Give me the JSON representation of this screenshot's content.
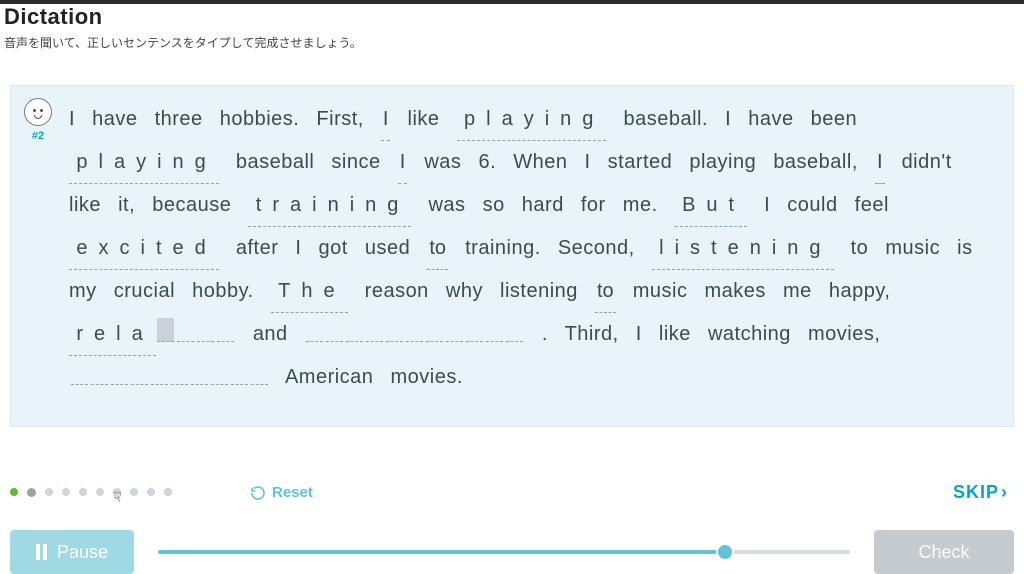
{
  "header": {
    "title": "Dictation",
    "subtitle": "音声を聞いて、正しいセンテンスをタイプして完成させましょう。"
  },
  "avatar": {
    "tag": "#2"
  },
  "tokens": [
    {
      "t": "w",
      "v": "I"
    },
    {
      "t": "w",
      "v": "have"
    },
    {
      "t": "w",
      "v": "three"
    },
    {
      "t": "w",
      "v": "hobbies."
    },
    {
      "t": "w",
      "v": "First,"
    },
    {
      "t": "fw",
      "v": "I"
    },
    {
      "t": "w",
      "v": "like"
    },
    {
      "t": "fw",
      "v": "playing"
    },
    {
      "t": "w",
      "v": "baseball."
    },
    {
      "t": "w",
      "v": "I"
    },
    {
      "t": "w",
      "v": "have"
    },
    {
      "t": "w",
      "v": "been"
    },
    {
      "t": "fw",
      "v": "playing"
    },
    {
      "t": "w",
      "v": "baseball"
    },
    {
      "t": "w",
      "v": "since"
    },
    {
      "t": "fw",
      "v": "I"
    },
    {
      "t": "w",
      "v": "was"
    },
    {
      "t": "w",
      "v": "6."
    },
    {
      "t": "w",
      "v": "When"
    },
    {
      "t": "w",
      "v": "I"
    },
    {
      "t": "w",
      "v": "started"
    },
    {
      "t": "w",
      "v": "playing"
    },
    {
      "t": "w",
      "v": "baseball,"
    },
    {
      "t": "fw",
      "v": "I"
    },
    {
      "t": "w",
      "v": "didn't"
    },
    {
      "t": "w",
      "v": "like"
    },
    {
      "t": "w",
      "v": "it,"
    },
    {
      "t": "w",
      "v": "because"
    },
    {
      "t": "fw",
      "v": "training"
    },
    {
      "t": "w",
      "v": "was"
    },
    {
      "t": "w",
      "v": "so"
    },
    {
      "t": "w",
      "v": "hard"
    },
    {
      "t": "w",
      "v": "for"
    },
    {
      "t": "w",
      "v": "me."
    },
    {
      "t": "fw",
      "v": "But"
    },
    {
      "t": "w",
      "v": "I"
    },
    {
      "t": "w",
      "v": "could"
    },
    {
      "t": "w",
      "v": "feel"
    },
    {
      "t": "fw",
      "v": "excited"
    },
    {
      "t": "w",
      "v": "after"
    },
    {
      "t": "w",
      "v": "I"
    },
    {
      "t": "w",
      "v": "got"
    },
    {
      "t": "w",
      "v": "used"
    },
    {
      "t": "fw",
      "v": "to"
    },
    {
      "t": "w",
      "v": "training."
    },
    {
      "t": "w",
      "v": "Second,"
    },
    {
      "t": "fw",
      "v": "listening"
    },
    {
      "t": "w",
      "v": "to"
    },
    {
      "t": "w",
      "v": "music"
    },
    {
      "t": "w",
      "v": "is"
    },
    {
      "t": "w",
      "v": "my"
    },
    {
      "t": "w",
      "v": "crucial"
    },
    {
      "t": "w",
      "v": "hobby."
    },
    {
      "t": "fw",
      "v": "The"
    },
    {
      "t": "w",
      "v": "reason"
    },
    {
      "t": "w",
      "v": "why"
    },
    {
      "t": "w",
      "v": "listening"
    },
    {
      "t": "fw",
      "v": "to"
    },
    {
      "t": "w",
      "v": "music"
    },
    {
      "t": "w",
      "v": "makes"
    },
    {
      "t": "w",
      "v": "me"
    },
    {
      "t": "w",
      "v": "happy,"
    },
    {
      "t": "partial",
      "filled": "rela",
      "cursor": true,
      "empty": 3
    },
    {
      "t": "w",
      "v": "and"
    },
    {
      "t": "blank",
      "n": 11
    },
    {
      "t": "p",
      "v": "."
    },
    {
      "t": "w",
      "v": "Third,"
    },
    {
      "t": "w",
      "v": "I"
    },
    {
      "t": "w",
      "v": "like"
    },
    {
      "t": "w",
      "v": "watching"
    },
    {
      "t": "w",
      "v": "movies,"
    },
    {
      "t": "blank",
      "n": 10
    },
    {
      "t": "w",
      "v": "American"
    },
    {
      "t": "w",
      "v": "movies."
    }
  ],
  "progress": {
    "total": 10,
    "done_index": 0,
    "current_index": 1
  },
  "controls": {
    "reset_label": "Reset",
    "skip_label": "SKIP",
    "pause_label": "Pause",
    "check_label": "Check"
  },
  "audio": {
    "position_pct": 82
  }
}
